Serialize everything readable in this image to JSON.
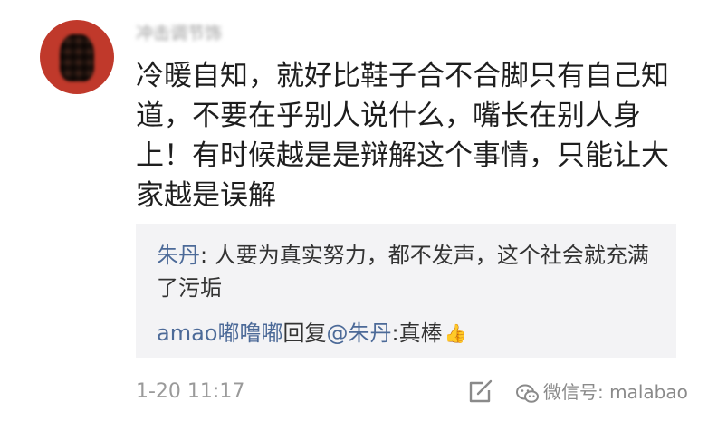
{
  "comment": {
    "username": "冲击调节饰",
    "text": "冷暖自知，就好比鞋子合不合脚只有自己知道，不要在乎别人说什么，嘴长在别人身上！有时候越是是辩解这个事情，只能让大家越是误解",
    "timestamp": "1-20 11:17"
  },
  "replies": [
    {
      "author": "朱丹",
      "separator": ": ",
      "text": "人要为真实努力，都不发声，这个社会就充满了污垢"
    },
    {
      "author": "amao嘟噜嘟",
      "connector": "回复",
      "mention": "@朱丹",
      "separator": ":",
      "text": "真棒",
      "emoji_icon": "thumbs-up-icon"
    }
  ],
  "watermark": {
    "text": "微信号: malabao",
    "icon": "wechat-icon"
  },
  "icons": {
    "edit": "edit-icon"
  },
  "colors": {
    "link": "#4c6a98",
    "reply_background": "#f3f3f5",
    "avatar_accent": "#c0392b"
  }
}
